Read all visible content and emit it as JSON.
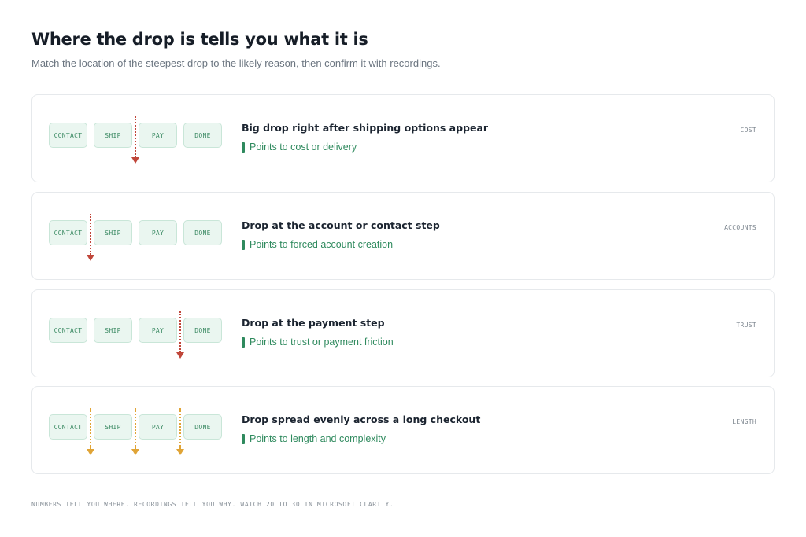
{
  "page": {
    "title": "Where the drop is tells you what it is",
    "subtitle": "Match the location of the steepest drop to the likely reason, then confirm it with recordings.",
    "footer": "NUMBERS TELL YOU WHERE. RECORDINGS TELL YOU WHY. WATCH 20 TO 30 IN MICROSOFT CLARITY."
  },
  "steps": [
    "CONTACT",
    "SHIP",
    "PAY",
    "DONE"
  ],
  "colors": {
    "step_fill": "#eaf6f0",
    "step_text": "#3b8a63",
    "drop_marker_red": "#c0463a",
    "drop_marker_amber": "#e0a436",
    "reason_text": "#2f8a5e"
  },
  "cards": [
    {
      "heading": "Big drop right after shipping options appear",
      "reason": "Points to cost or delivery",
      "tag": "COST",
      "drop_after_steps": [
        "SHIP"
      ],
      "marker_color": "red"
    },
    {
      "heading": "Drop at the account or contact step",
      "reason": "Points to forced account creation",
      "tag": "ACCOUNTS",
      "drop_after_steps": [
        "CONTACT"
      ],
      "marker_color": "red"
    },
    {
      "heading": "Drop at the payment step",
      "reason": "Points to trust or payment friction",
      "tag": "TRUST",
      "drop_after_steps": [
        "PAY"
      ],
      "marker_color": "red"
    },
    {
      "heading": "Drop spread evenly across a long checkout",
      "reason": "Points to length and complexity",
      "tag": "LENGTH",
      "drop_after_steps": [
        "CONTACT",
        "SHIP",
        "PAY"
      ],
      "marker_color": "amber"
    }
  ]
}
